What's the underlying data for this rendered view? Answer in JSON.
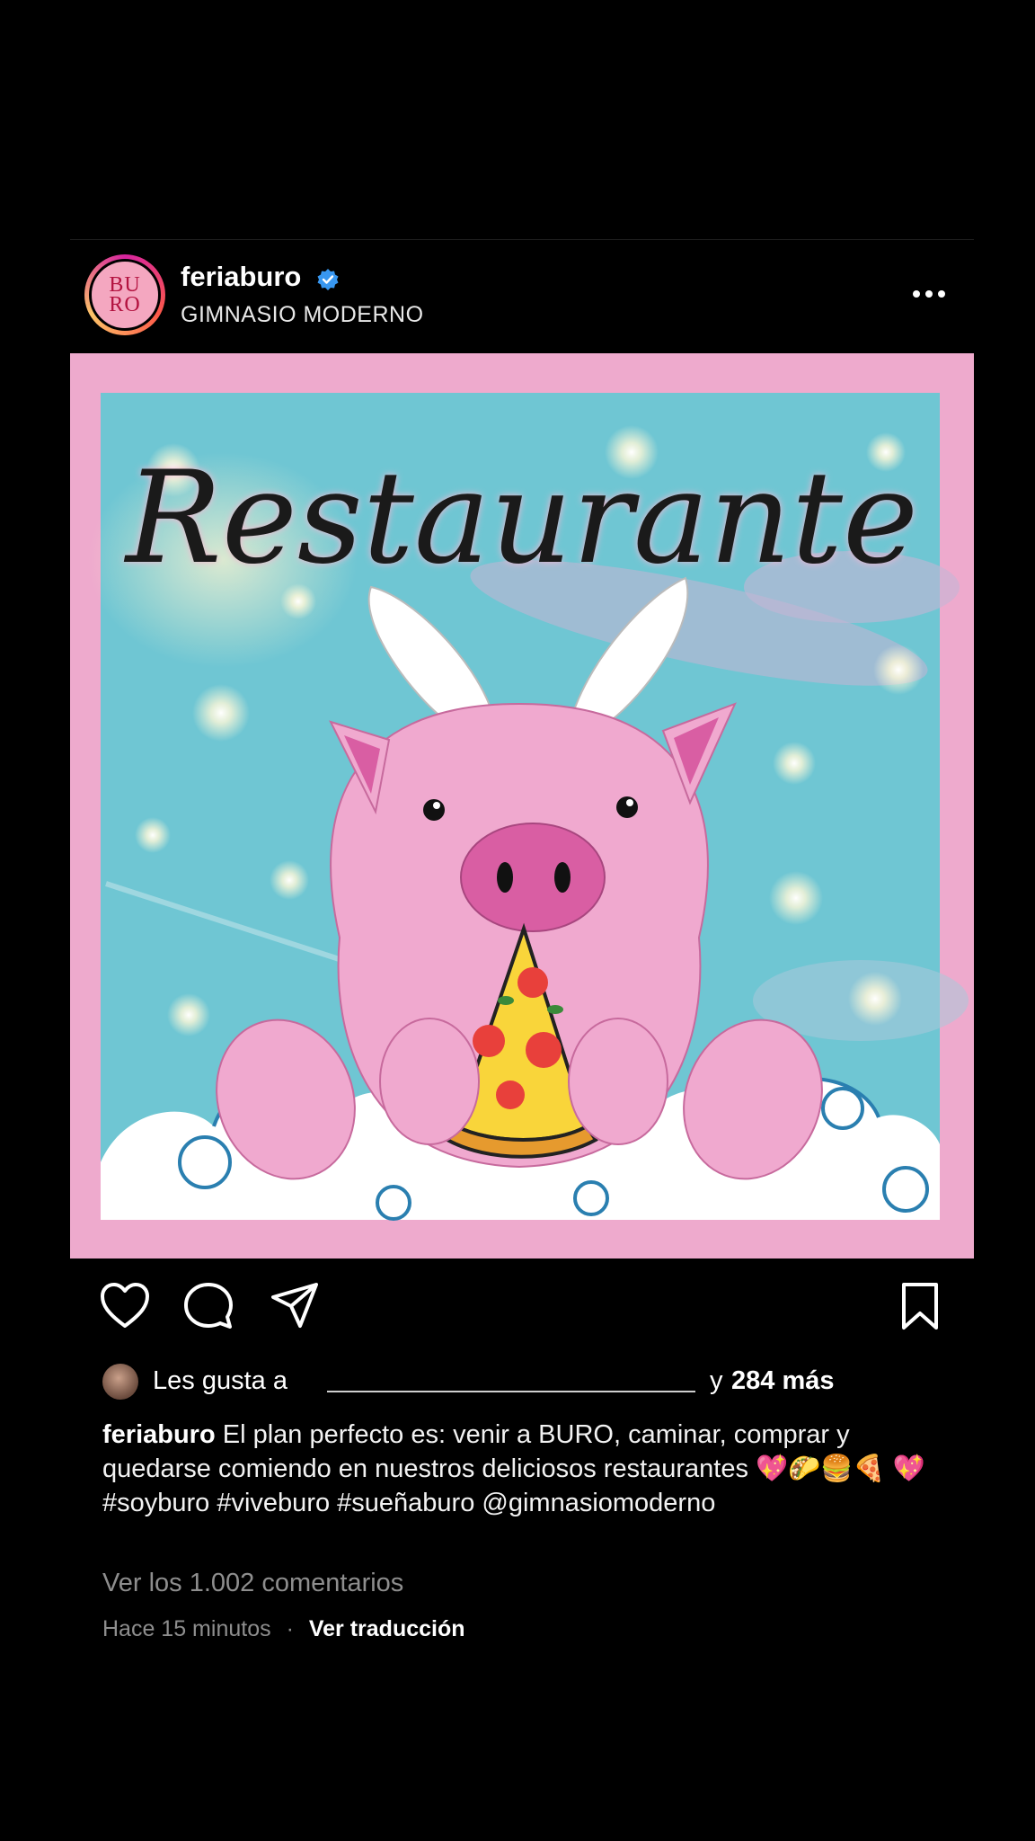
{
  "post": {
    "username": "feriaburo",
    "location": "GIMNASIO MODERNO",
    "avatar_text": [
      "BU",
      "RO"
    ],
    "image_title": "Restaurante"
  },
  "likes": {
    "prefix": "Les gusta a",
    "conjunction": "y",
    "count_text": "284 más"
  },
  "caption": {
    "username": "feriaburo",
    "text": "El plan perfecto es: venir a BURO, caminar, comprar y quedarse comiendo en nuestros deliciosos restaurantes 💖🌮🍔🍕 💖 #soyburo #viveburo #sueñaburo @gimnasiomoderno"
  },
  "comments_link": "Ver los 1.002 comentarios",
  "timestamp": "Hace 15 minutos",
  "separator": "·",
  "translate_link": "Ver traducción",
  "icons": [
    "verified-icon",
    "more-options-icon",
    "heart-icon",
    "comment-icon",
    "share-icon",
    "bookmark-icon"
  ],
  "colors": {
    "background": "#000000",
    "verified": "#3897f0",
    "image_border": "#eeaacd",
    "sky": "#6fc6d3",
    "pig": "#f0a9cf",
    "muted_text": "#8e8e8e"
  }
}
